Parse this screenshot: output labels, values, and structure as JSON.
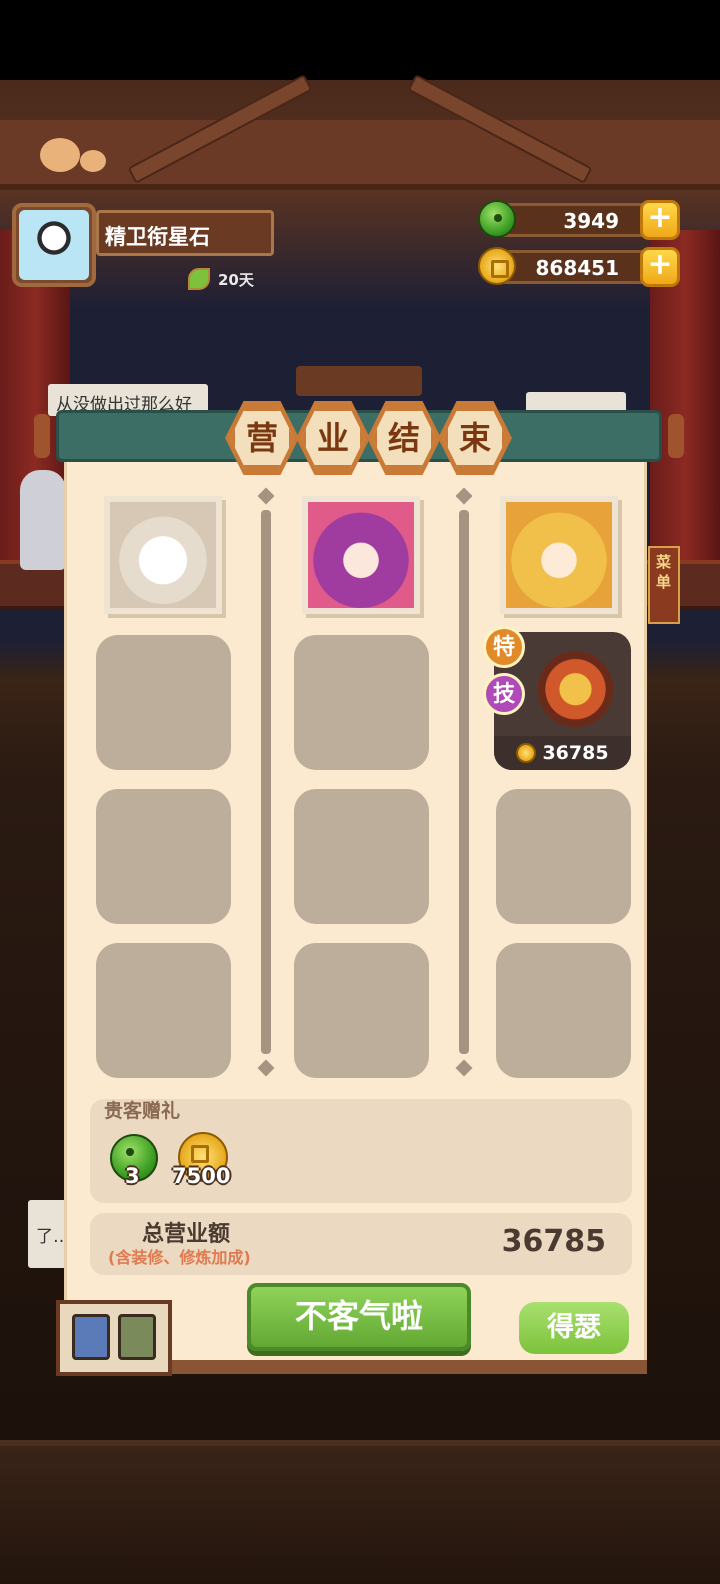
{
  "player": {
    "name": "精卫衔星石",
    "days": "20天"
  },
  "currency": {
    "jade": "3949",
    "coins": "868451"
  },
  "background": {
    "speech_left": "从没做出过那么好",
    "speech_left2": "了…",
    "side_menu": "菜单"
  },
  "panel": {
    "title_chars": [
      "营",
      "业",
      "结",
      "束"
    ],
    "skill_badge_1": "特",
    "skill_badge_2": "技",
    "dish_price": "36785",
    "gift_title": "贵客赠礼",
    "gift_jade_count": "3",
    "gift_coin_count": "7500",
    "total_label": "总营业额",
    "total_note": "(含装修、修炼加成)",
    "total_value": "36785",
    "main_button": "不客气啦",
    "side_button": "得瑟"
  },
  "colors": {
    "panel_bg": "#fbead0",
    "slot_empty": "#bcae9b",
    "accent_green": "#62a832",
    "title_orange": "#c87a36"
  }
}
